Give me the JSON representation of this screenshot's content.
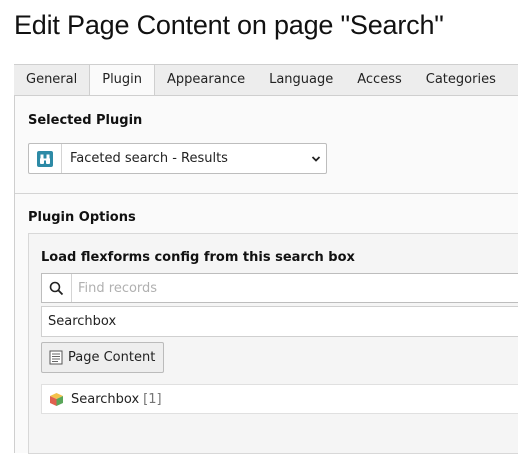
{
  "page": {
    "title": "Edit Page Content on page \"Search\""
  },
  "tabs": [
    {
      "label": "General",
      "active": false
    },
    {
      "label": "Plugin",
      "active": true
    },
    {
      "label": "Appearance",
      "active": false
    },
    {
      "label": "Language",
      "active": false
    },
    {
      "label": "Access",
      "active": false
    },
    {
      "label": "Categories",
      "active": false
    },
    {
      "label": "N",
      "active": false
    }
  ],
  "selected_plugin": {
    "heading": "Selected Plugin",
    "value": "Faceted search - Results",
    "icon": "binoculars-icon",
    "icon_color": "#2d8aa6"
  },
  "plugin_options": {
    "heading": "Plugin Options",
    "field_label": "Load flexforms config from this search box",
    "search_placeholder": "Find records",
    "search_icon": "search-icon",
    "selected_value": "Searchbox",
    "page_content_button": "Page Content",
    "record": {
      "title": "Searchbox",
      "uid": "[1]",
      "icon": "box-icon"
    }
  }
}
